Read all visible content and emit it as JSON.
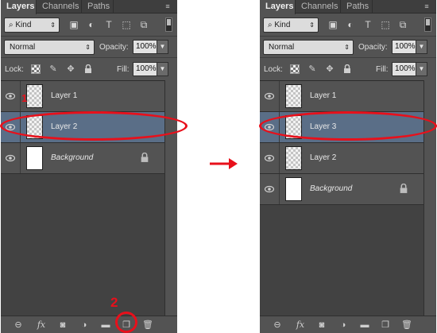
{
  "tabs": {
    "layers": "Layers",
    "channels": "Channels",
    "paths": "Paths"
  },
  "filter": {
    "kind_label": "Kind"
  },
  "blend": {
    "mode": "Normal",
    "opacity_label": "Opacity:",
    "opacity_value": "100%"
  },
  "lock": {
    "label": "Lock:",
    "fill_label": "Fill:",
    "fill_value": "100%"
  },
  "before": {
    "layers": [
      {
        "name": "Layer 1"
      },
      {
        "name": "Layer 2"
      },
      {
        "name": "Background"
      }
    ]
  },
  "after": {
    "layers": [
      {
        "name": "Layer 1"
      },
      {
        "name": "Layer 3"
      },
      {
        "name": "Layer 2"
      },
      {
        "name": "Background"
      }
    ]
  },
  "annotations": {
    "step1": "1",
    "step2": "2"
  },
  "colors": {
    "annotation_red": "#e8101b",
    "selected_layer": "#5a6e87",
    "panel_bg": "#535353"
  },
  "icons": {
    "filter": [
      "image-filter-icon",
      "adjustment-filter-icon",
      "type-filter-icon",
      "shape-filter-icon",
      "smart-object-filter-icon"
    ],
    "lock": [
      "lock-transparent-pixels-icon",
      "lock-image-pixels-icon",
      "lock-position-icon",
      "lock-all-icon"
    ],
    "bottom": [
      "link-layers-icon",
      "fx-icon",
      "add-mask-icon",
      "new-adjustment-icon",
      "new-group-icon",
      "new-layer-icon",
      "trash-icon"
    ]
  }
}
